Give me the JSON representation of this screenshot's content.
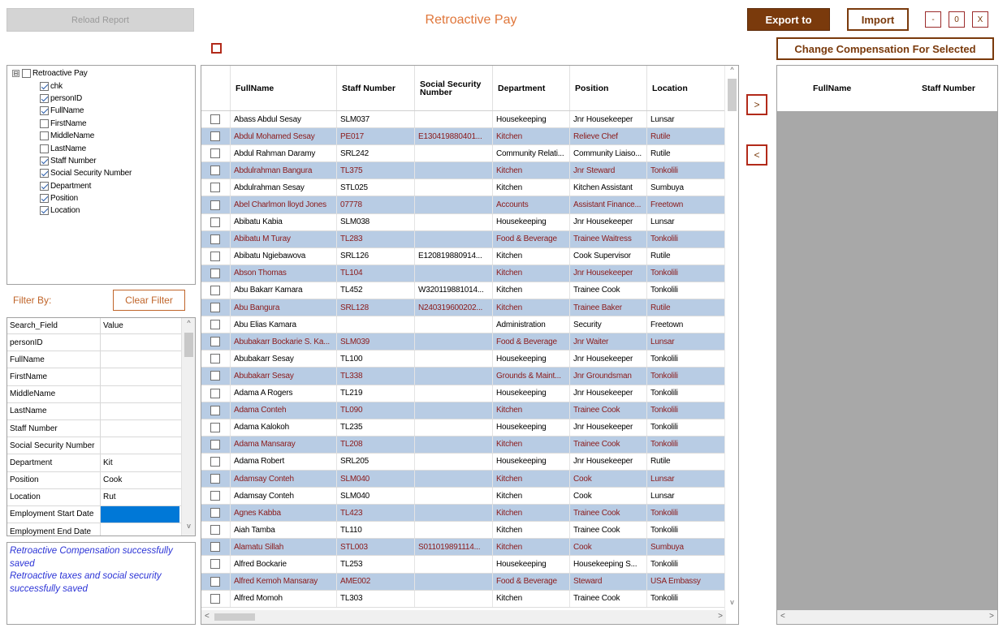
{
  "window": {
    "title": "Retroactive Pay",
    "reload_label": "Reload Report",
    "export_label": "Export to",
    "import_label": "Import",
    "minimize_label": "-",
    "maximize_label": "0",
    "close_label": "X",
    "change_comp_label": "Change Compensation For Selected",
    "move_right_label": ">",
    "move_left_label": "<"
  },
  "tree": {
    "root": {
      "label": "Retroactive Pay",
      "expander": "⊟"
    },
    "items": [
      {
        "label": "chk",
        "checked": true
      },
      {
        "label": "personID",
        "checked": true
      },
      {
        "label": "FullName",
        "checked": true
      },
      {
        "label": "FirstName",
        "checked": false
      },
      {
        "label": "MiddleName",
        "checked": false
      },
      {
        "label": "LastName",
        "checked": false
      },
      {
        "label": "Staff Number",
        "checked": true
      },
      {
        "label": "Social Security Number",
        "checked": true
      },
      {
        "label": "Department",
        "checked": true
      },
      {
        "label": "Position",
        "checked": true
      },
      {
        "label": "Location",
        "checked": true
      }
    ]
  },
  "filter": {
    "label": "Filter By:",
    "clear_label": "Clear Filter",
    "headers": [
      "Search_Field",
      "Value"
    ],
    "rows": [
      [
        "personID",
        ""
      ],
      [
        "FullName",
        ""
      ],
      [
        "FirstName",
        ""
      ],
      [
        "MiddleName",
        ""
      ],
      [
        "LastName",
        ""
      ],
      [
        "Staff Number",
        ""
      ],
      [
        "Social Security Number",
        ""
      ],
      [
        "Department",
        "Kit"
      ],
      [
        "Position",
        "Cook"
      ],
      [
        "Location",
        "Rut"
      ],
      [
        "Employment Start Date",
        ""
      ],
      [
        "Employment End Date",
        ""
      ]
    ]
  },
  "messages": [
    "Retroactive Compensation successfully saved",
    "Retroactive taxes and social security successfully saved"
  ],
  "main_grid": {
    "headers": [
      "FullName",
      "Staff Number",
      "Social Security Number",
      "Department",
      "Position",
      "Location"
    ],
    "rows": [
      [
        "Abass Abdul Sesay",
        "SLM037",
        "",
        "Housekeeping",
        "Jnr Housekeeper",
        "Lunsar"
      ],
      [
        "Abdul Mohamed Sesay",
        "PE017",
        "E130419880401...",
        "Kitchen",
        "Relieve Chef",
        "Rutile"
      ],
      [
        "Abdul Rahman Daramy",
        "SRL242",
        "",
        "Community Relati...",
        "Community Liaiso...",
        "Rutile"
      ],
      [
        "Abdulrahman Bangura",
        "TL375",
        "",
        "Kitchen",
        "Jnr Steward",
        "Tonkolili"
      ],
      [
        "Abdulrahman Sesay",
        "STL025",
        "",
        "Kitchen",
        "Kitchen Assistant",
        "Sumbuya"
      ],
      [
        "Abel Charlmon lloyd Jones",
        "07778",
        "",
        "Accounts",
        "Assistant Finance...",
        "Freetown"
      ],
      [
        "Abibatu Kabia",
        "SLM038",
        "",
        "Housekeeping",
        "Jnr Housekeeper",
        "Lunsar"
      ],
      [
        "Abibatu M Turay",
        "TL283",
        "",
        "Food & Beverage",
        "Trainee Waitress",
        "Tonkolili"
      ],
      [
        "Abibatu Ngiebawova",
        "SRL126",
        "E120819880914...",
        "Kitchen",
        "Cook Supervisor",
        "Rutile"
      ],
      [
        "Abson Thomas",
        "TL104",
        "",
        "Kitchen",
        "Jnr Housekeeper",
        "Tonkolili"
      ],
      [
        "Abu Bakarr Kamara",
        "TL452",
        "W320119881014...",
        "Kitchen",
        "Trainee Cook",
        "Tonkolili"
      ],
      [
        "Abu Bangura",
        "SRL128",
        "N240319600202...",
        "Kitchen",
        "Trainee Baker",
        "Rutile"
      ],
      [
        "Abu Elias Kamara",
        "",
        "",
        "Administration",
        "Security",
        "Freetown"
      ],
      [
        "Abubakarr Bockarie S. Ka...",
        "SLM039",
        "",
        "Food & Beverage",
        "Jnr Waiter",
        "Lunsar"
      ],
      [
        "Abubakarr Sesay",
        "TL100",
        "",
        "Housekeeping",
        "Jnr Housekeeper",
        "Tonkolili"
      ],
      [
        "Abubakarr Sesay",
        "TL338",
        "",
        "Grounds & Maint...",
        "Jnr Groundsman",
        "Tonkolili"
      ],
      [
        "Adama A Rogers",
        "TL219",
        "",
        "Housekeeping",
        "Jnr Housekeeper",
        "Tonkolili"
      ],
      [
        "Adama Conteh",
        "TL090",
        "",
        "Kitchen",
        "Trainee Cook",
        "Tonkolili"
      ],
      [
        "Adama Kalokoh",
        "TL235",
        "",
        "Housekeeping",
        "Jnr Housekeeper",
        "Tonkolili"
      ],
      [
        "Adama Mansaray",
        "TL208",
        "",
        "Kitchen",
        "Trainee Cook",
        "Tonkolili"
      ],
      [
        "Adama Robert",
        "SRL205",
        "",
        "Housekeeping",
        "Jnr Housekeeper",
        "Rutile"
      ],
      [
        "Adamsay Conteh",
        "SLM040",
        "",
        "Kitchen",
        "Cook",
        "Lunsar"
      ],
      [
        "Adamsay Conteh",
        "SLM040",
        "",
        "Kitchen",
        "Cook",
        "Lunsar"
      ],
      [
        "Agnes Kabba",
        "TL423",
        "",
        "Kitchen",
        "Trainee Cook",
        "Tonkolili"
      ],
      [
        "Aiah Tamba",
        "TL110",
        "",
        "Kitchen",
        "Trainee Cook",
        "Tonkolili"
      ],
      [
        "Alamatu Sillah",
        "STL003",
        "S011019891114...",
        "Kitchen",
        "Cook",
        "Sumbuya"
      ],
      [
        "Alfred Bockarie",
        "TL253",
        "",
        "Housekeeping",
        "Housekeeping S...",
        "Tonkolili"
      ],
      [
        "Alfred Kemoh Mansaray",
        "AME002",
        "",
        "Food & Beverage",
        "Steward",
        "USA Embassy"
      ],
      [
        "Alfred Momoh",
        "TL303",
        "",
        "Kitchen",
        "Trainee Cook",
        "Tonkolili"
      ]
    ]
  },
  "right_grid": {
    "headers": [
      "FullName",
      "Staff Number"
    ]
  },
  "scroll": {
    "up": "^",
    "down": "v",
    "left": "<",
    "right": ">"
  }
}
